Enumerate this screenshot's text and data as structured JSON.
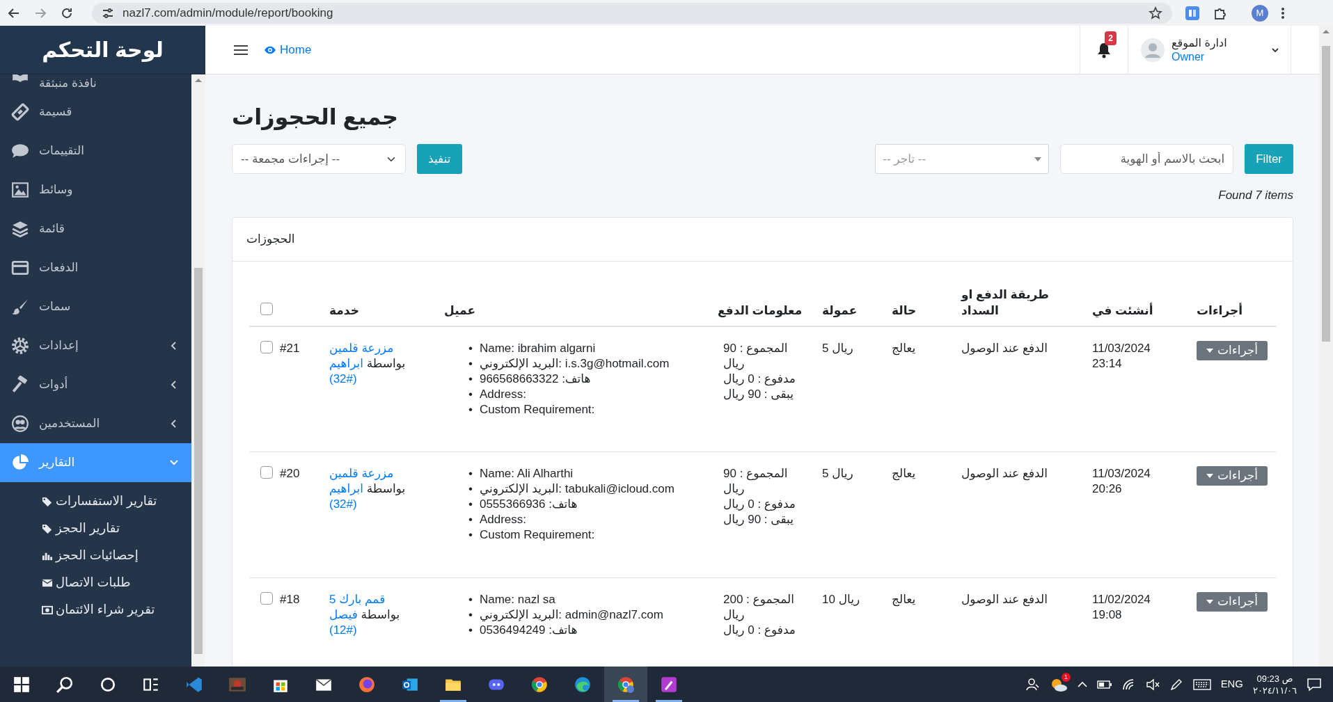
{
  "browser": {
    "url": "nazl7.com/admin/module/report/booking",
    "profile_initial": "M"
  },
  "sidebar": {
    "title": "لوحة التحكم",
    "items": [
      {
        "label": "نافذة منبثقة",
        "kind": "link",
        "selected": false,
        "expanded": false
      },
      {
        "label": "قسيمة",
        "kind": "link",
        "selected": false,
        "expanded": false
      },
      {
        "label": "التقييمات",
        "kind": "link",
        "selected": false,
        "expanded": false
      },
      {
        "label": "وسائط",
        "kind": "link",
        "selected": false,
        "expanded": false
      },
      {
        "label": "قائمة",
        "kind": "link",
        "selected": false,
        "expanded": false
      },
      {
        "label": "الدفعات",
        "kind": "link",
        "selected": false,
        "expanded": false
      },
      {
        "label": "سمات",
        "kind": "link",
        "selected": false,
        "expanded": false
      },
      {
        "label": "إعدادات",
        "kind": "group",
        "selected": false,
        "expanded": false
      },
      {
        "label": "أدوات",
        "kind": "group",
        "selected": false,
        "expanded": false
      },
      {
        "label": "المستخدمين",
        "kind": "group",
        "selected": false,
        "expanded": false
      },
      {
        "label": "التقارير",
        "kind": "group",
        "selected": true,
        "expanded": true,
        "children": [
          {
            "label": "تقارير الاستفسارات"
          },
          {
            "label": "تقارير الحجز"
          },
          {
            "label": "إحصائيات الحجز"
          },
          {
            "label": "طلبات الاتصال"
          },
          {
            "label": "تقرير شراء الائتمان"
          }
        ]
      }
    ]
  },
  "navbar": {
    "home": "Home",
    "notifications": "2",
    "user": {
      "name": "ادارة الموقع",
      "role": "Owner"
    }
  },
  "page": {
    "title": "جميع الحجوزات",
    "bulk_action": {
      "placeholder": "-- إجراءات مجمعة --"
    },
    "apply": "تنفيذ",
    "vendor": {
      "placeholder": "-- تاجر --"
    },
    "search": {
      "placeholder": "ابحث بالاسم أو الهوية"
    },
    "filter": "Filter",
    "found": "Found 7 items"
  },
  "card": {
    "title": "الحجوزات",
    "select_all_checked": false,
    "columns": [
      "أجراءات",
      "أنشئت في",
      "طريقة الدفع او السداد",
      "حالة",
      "عمولة",
      "معلومات الدفع",
      "عميل",
      "خدمة"
    ],
    "bullet": "•",
    "rows": [
      {
        "checked": false,
        "id": "#21",
        "service": "مزرعة قلمين",
        "by": "بواسطة",
        "vendor": "ابراهيم",
        "vendor_id": "(32#)",
        "customer": [
          "Name: ibrahim algarni",
          "البريد الإلكتروني: i.s.3g@hotmail.com",
          "هاتف: 966568663322",
          "Address:",
          "Custom Requirement:"
        ],
        "payment": [
          "المجموع : 90 ريال",
          "مدفوع : 0 ريال",
          "يبقى : 90 ريال"
        ],
        "commission": "ريال 5",
        "status": "يعالج",
        "method": "الدفع عند الوصول",
        "date": "11/03/2024",
        "time": "23:14",
        "action": "أجراءات"
      },
      {
        "checked": false,
        "id": "#20",
        "service": "مزرعة قلمين",
        "by": "بواسطة",
        "vendor": "ابراهيم",
        "vendor_id": "(32#)",
        "customer": [
          "Name: Ali Alharthi",
          "البريد الإلكتروني: tabukali@icloud.com",
          "هاتف: 0555366936",
          "Address:",
          "Custom Requirement:"
        ],
        "payment": [
          "المجموع : 90 ريال",
          "مدفوع : 0 ريال",
          "يبقى : 90 ريال"
        ],
        "commission": "ريال 5",
        "status": "يعالج",
        "method": "الدفع عند الوصول",
        "date": "11/03/2024",
        "time": "20:26",
        "action": "أجراءات"
      },
      {
        "checked": false,
        "id": "#18",
        "service": "قمم بارك 5",
        "by": "بواسطة",
        "vendor": "فيصل",
        "vendor_id": "(12#)",
        "customer": [
          "Name: nazl sa",
          "البريد الإلكتروني: admin@nazl7.com",
          "هاتف: 0536494249"
        ],
        "payment": [
          "المجموع : 200 ريال",
          "مدفوع : 0 ريال"
        ],
        "commission": "ريال 10",
        "status": "يعالج",
        "method": "الدفع عند الوصول",
        "date": "11/02/2024",
        "time": "19:08",
        "action": "أجراءات"
      }
    ]
  },
  "taskbar": {
    "apps": [
      {
        "running": false,
        "selected": false
      },
      {
        "running": false,
        "selected": false
      },
      {
        "running": false,
        "selected": false
      },
      {
        "running": false,
        "selected": false
      },
      {
        "running": false,
        "selected": false
      },
      {
        "running": false,
        "selected": false
      },
      {
        "running": false,
        "selected": false
      },
      {
        "running": false,
        "selected": false
      },
      {
        "running": false,
        "selected": false
      },
      {
        "running": false,
        "selected": false
      },
      {
        "running": true,
        "selected": false
      },
      {
        "running": false,
        "selected": false
      },
      {
        "running": false,
        "selected": false
      },
      {
        "running": false,
        "selected": false
      },
      {
        "running": true,
        "selected": true
      },
      {
        "running": true,
        "selected": false
      }
    ],
    "weather_badge": "1",
    "language": "ENG",
    "time": "09:23 ص",
    "date": "٢٠٢٤/١١/٠٦"
  }
}
